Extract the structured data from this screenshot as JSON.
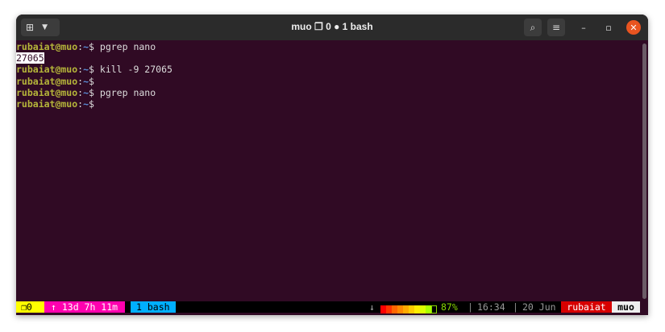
{
  "window": {
    "title": "muo ❐ 0 ● 1 bash",
    "new_tab_icon": "new-tab-icon",
    "menu_icon": "chevron-down-icon"
  },
  "terminal": {
    "lines": [
      {
        "user": "rubaiat@muo",
        "path": "~",
        "sym": "$",
        "cmd": " pgrep nano"
      },
      {
        "output": "27065"
      },
      {
        "user": "rubaiat@muo",
        "path": "~",
        "sym": "$",
        "cmd": " kill -9 27065"
      },
      {
        "user": "rubaiat@muo",
        "path": "~",
        "sym": "$",
        "cmd": ""
      },
      {
        "user": "rubaiat@muo",
        "path": "~",
        "sym": "$",
        "cmd": " pgrep nano"
      },
      {
        "user": "rubaiat@muo",
        "path": "~",
        "sym": "$",
        "cmd": ""
      }
    ]
  },
  "status": {
    "session": "❐0",
    "uptime": "↑ 13d 7h 11m",
    "window": "1 bash",
    "arrow": "↓",
    "battery_percent": 87,
    "battery_label": "87%",
    "sep": "|",
    "time": "16:34",
    "date": "20 Jun",
    "user": "rubaiat",
    "host": "muo",
    "colors": {
      "yellow": "#ffff00",
      "pink": "#ff00af",
      "blue": "#00afff",
      "red": "#d70000",
      "battery_text": "#87d700"
    }
  }
}
